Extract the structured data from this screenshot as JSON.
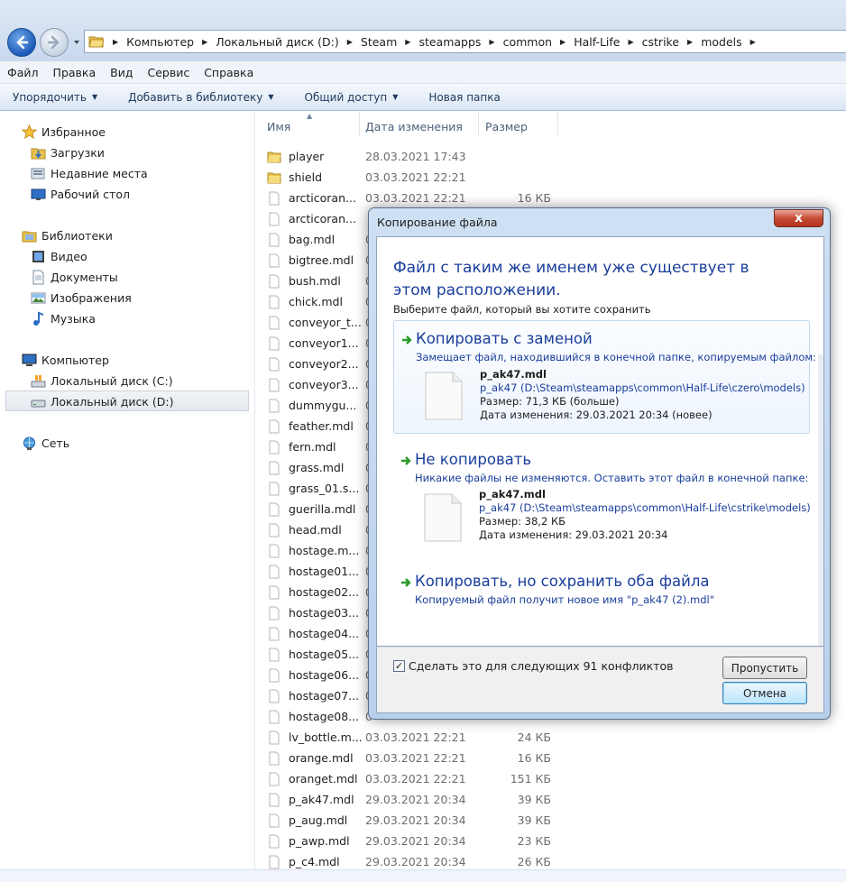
{
  "breadcrumbs": [
    "Компьютер",
    "Локальный диск (D:)",
    "Steam",
    "steamapps",
    "common",
    "Half-Life",
    "cstrike",
    "models"
  ],
  "menu": [
    "Файл",
    "Правка",
    "Вид",
    "Сервис",
    "Справка"
  ],
  "commands": {
    "organize": "Упорядочить",
    "add_library": "Добавить в библиотеку",
    "share": "Общий доступ",
    "new_folder": "Новая папка"
  },
  "sidebar": {
    "favorites": "Избранное",
    "downloads": "Загрузки",
    "recent": "Недавние места",
    "desktop": "Рабочий стол",
    "libraries": "Библиотеки",
    "video": "Видео",
    "documents": "Документы",
    "images": "Изображения",
    "music": "Музыка",
    "computer": "Компьютер",
    "disk_c": "Локальный диск (C:)",
    "disk_d": "Локальный диск (D:)",
    "network": "Сеть"
  },
  "columns": {
    "name": "Имя",
    "date": "Дата изменения",
    "size": "Размер"
  },
  "files": [
    {
      "name": "player",
      "date": "28.03.2021 17:43",
      "size": "",
      "type": "folder"
    },
    {
      "name": "shield",
      "date": "03.03.2021 22:21",
      "size": "",
      "type": "folder"
    },
    {
      "name": "arcticoran...",
      "date": "03.03.2021 22:21",
      "size": "16 КБ",
      "type": "file"
    },
    {
      "name": "arcticoran...",
      "date": "",
      "size": "",
      "type": "file"
    },
    {
      "name": "bag.mdl",
      "date": "0",
      "size": "",
      "type": "file"
    },
    {
      "name": "bigtree.mdl",
      "date": "0",
      "size": "",
      "type": "file"
    },
    {
      "name": "bush.mdl",
      "date": "0",
      "size": "",
      "type": "file"
    },
    {
      "name": "chick.mdl",
      "date": "0",
      "size": "",
      "type": "file"
    },
    {
      "name": "conveyor_t...",
      "date": "0",
      "size": "",
      "type": "file"
    },
    {
      "name": "conveyor1...",
      "date": "0",
      "size": "",
      "type": "file"
    },
    {
      "name": "conveyor2...",
      "date": "0",
      "size": "",
      "type": "file"
    },
    {
      "name": "conveyor3...",
      "date": "0",
      "size": "",
      "type": "file"
    },
    {
      "name": "dummygu...",
      "date": "0",
      "size": "",
      "type": "file"
    },
    {
      "name": "feather.mdl",
      "date": "0",
      "size": "",
      "type": "file"
    },
    {
      "name": "fern.mdl",
      "date": "0",
      "size": "",
      "type": "file"
    },
    {
      "name": "grass.mdl",
      "date": "0",
      "size": "",
      "type": "file"
    },
    {
      "name": "grass_01.s...",
      "date": "0",
      "size": "",
      "type": "file"
    },
    {
      "name": "guerilla.mdl",
      "date": "0",
      "size": "",
      "type": "file"
    },
    {
      "name": "head.mdl",
      "date": "0",
      "size": "",
      "type": "file"
    },
    {
      "name": "hostage.m...",
      "date": "0",
      "size": "",
      "type": "file"
    },
    {
      "name": "hostage01...",
      "date": "0",
      "size": "",
      "type": "file"
    },
    {
      "name": "hostage02...",
      "date": "0",
      "size": "",
      "type": "file"
    },
    {
      "name": "hostage03...",
      "date": "0",
      "size": "",
      "type": "file"
    },
    {
      "name": "hostage04...",
      "date": "0",
      "size": "",
      "type": "file"
    },
    {
      "name": "hostage05...",
      "date": "0",
      "size": "",
      "type": "file"
    },
    {
      "name": "hostage06...",
      "date": "0",
      "size": "",
      "type": "file"
    },
    {
      "name": "hostage07...",
      "date": "0",
      "size": "",
      "type": "file"
    },
    {
      "name": "hostage08...",
      "date": "0",
      "size": "",
      "type": "file"
    },
    {
      "name": "lv_bottle.m...",
      "date": "03.03.2021 22:21",
      "size": "24 КБ",
      "type": "file"
    },
    {
      "name": "orange.mdl",
      "date": "03.03.2021 22:21",
      "size": "16 КБ",
      "type": "file"
    },
    {
      "name": "oranget.mdl",
      "date": "03.03.2021 22:21",
      "size": "151 КБ",
      "type": "file"
    },
    {
      "name": "p_ak47.mdl",
      "date": "29.03.2021 20:34",
      "size": "39 КБ",
      "type": "file"
    },
    {
      "name": "p_aug.mdl",
      "date": "29.03.2021 20:34",
      "size": "39 КБ",
      "type": "file"
    },
    {
      "name": "p_awp.mdl",
      "date": "29.03.2021 20:34",
      "size": "23 КБ",
      "type": "file"
    },
    {
      "name": "p_c4.mdl",
      "date": "29.03.2021 20:34",
      "size": "26 КБ",
      "type": "file"
    }
  ],
  "dialog": {
    "title": "Копирование файла",
    "close": "x",
    "headline": "Файл с таким же именем уже существует в этом расположении.",
    "subhead": "Выберите файл, который вы хотите сохранить",
    "replace": {
      "title": "Копировать с заменой",
      "desc": "Замещает файл, находившийся в конечной папке, копируемым файлом:",
      "file_name": "p_ak47.mdl",
      "file_path": "p_ak47 (D:\\Steam\\steamapps\\common\\Half-Life\\czero\\models)",
      "file_size": "Размер: 71,3 КБ (больше)",
      "file_date": "Дата изменения: 29.03.2021 20:34 (новее)"
    },
    "skip": {
      "title": "Не копировать",
      "desc": "Никакие файлы не изменяются. Оставить этот файл в конечной папке:",
      "file_name": "p_ak47.mdl",
      "file_path": "p_ak47 (D:\\Steam\\steamapps\\common\\Half-Life\\cstrike\\models)",
      "file_size": "Размер: 38,2 КБ",
      "file_date": "Дата изменения: 29.03.2021 20:34"
    },
    "keep_both": {
      "title": "Копировать, но сохранить оба файла",
      "desc": "Копируемый файл получит новое имя \"p_ak47 (2).mdl\""
    },
    "checkbox_label": "Сделать это для следующих 91 конфликтов",
    "checkbox_checked": true,
    "skip_button": "Пропустить",
    "cancel_button": "Отмена"
  }
}
